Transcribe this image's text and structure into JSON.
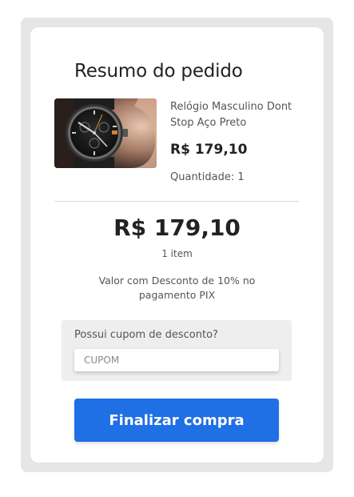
{
  "summary": {
    "title": "Resumo do pedido"
  },
  "product": {
    "name": "Relógio Masculino Dont Stop Aço Preto",
    "price": "R$ 179,10",
    "quantity_text": "Quantidade: 1",
    "image_icon": "watch-photo"
  },
  "totals": {
    "total": "R$ 179,10",
    "item_count": "1 item",
    "discount_note": "Valor com Desconto de 10% no pagamento PIX"
  },
  "coupon": {
    "label": "Possui cupom de desconto?",
    "placeholder": "CUPOM",
    "value": ""
  },
  "actions": {
    "finalize_label": "Finalizar compra"
  },
  "colors": {
    "primary": "#1f6fe5",
    "card_background": "#ffffff",
    "frame_background": "#e6e6e6",
    "coupon_background": "#eeeeee"
  }
}
